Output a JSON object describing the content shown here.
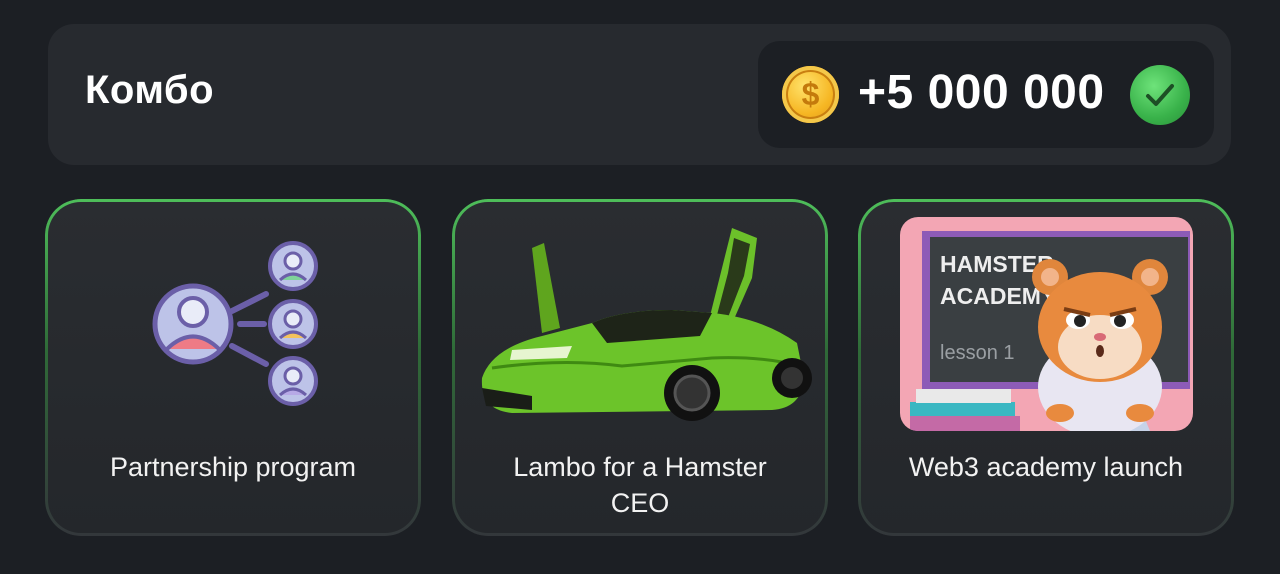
{
  "combo": {
    "title": "Комбо",
    "reward_amount": "+5 000 000",
    "coin_symbol": "$",
    "status": "completed"
  },
  "cards": [
    {
      "label": "Partnership program",
      "icon": "partnership-network-icon"
    },
    {
      "label": "Lambo for a Hamster CEO",
      "icon": "green-lambo-image"
    },
    {
      "label": "Web3 academy launch",
      "icon": "hamster-academy-image",
      "image_text": {
        "line1": "HAMSTER",
        "line2": "ACADEMY",
        "line3": "lesson 1"
      }
    }
  ],
  "colors": {
    "background": "#1c1f24",
    "panel": "#272a2f",
    "accent_green": "#4ebe5a",
    "coin_gold": "#f6b623"
  }
}
